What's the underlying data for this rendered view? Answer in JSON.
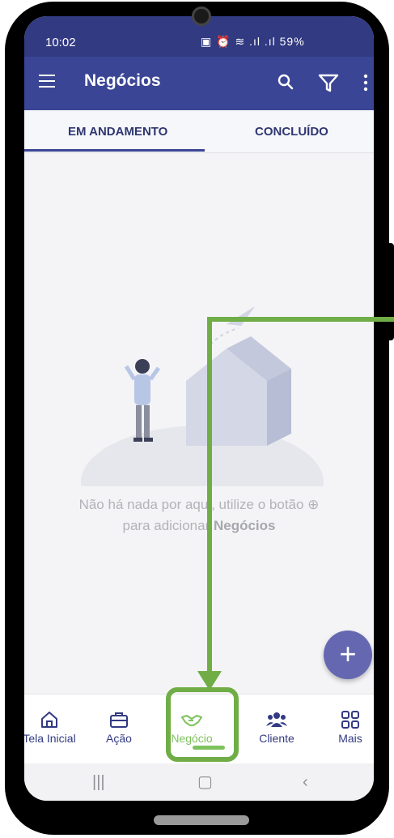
{
  "statusbar": {
    "time": "10:02",
    "battery": "59%"
  },
  "appbar": {
    "title": "Negócios"
  },
  "tabs": [
    {
      "label": "EM ANDAMENTO"
    },
    {
      "label": "CONCLUÍDO"
    }
  ],
  "empty_state": {
    "line1": "Não há nada por aqui, utilize o botão ⊕",
    "line2_prefix": "para adicionar ",
    "line2_bold": "Negócios"
  },
  "fab": {
    "label": "+"
  },
  "bottom_nav": [
    {
      "label": "Tela Inicial",
      "icon": "home-icon"
    },
    {
      "label": "Ação",
      "icon": "briefcase-icon"
    },
    {
      "label": "Negócio",
      "icon": "handshake-icon",
      "active": true
    },
    {
      "label": "Cliente",
      "icon": "people-icon"
    },
    {
      "label": "Mais",
      "icon": "grid-icon"
    }
  ],
  "colors": {
    "primary": "#3b4595",
    "statusbar": "#323a82",
    "accent": "#6568b1",
    "active_nav": "#7ec25e",
    "callout": "#70ad47"
  }
}
